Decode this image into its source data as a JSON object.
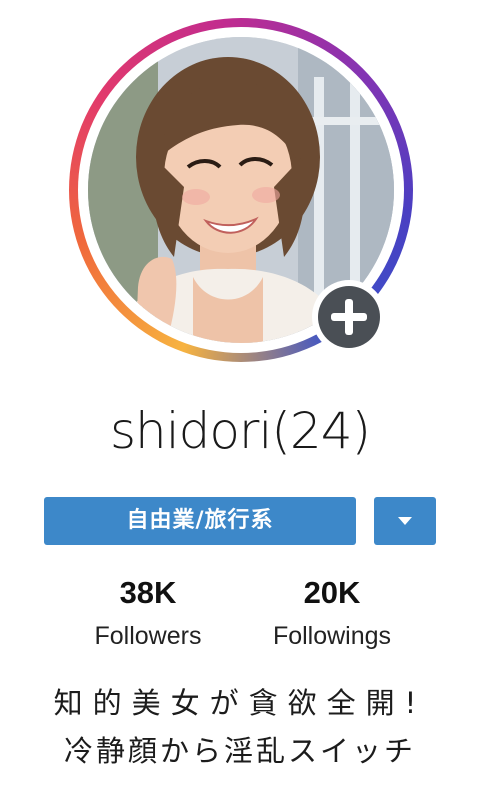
{
  "profile": {
    "username": "shidori(24)",
    "category_label": "自由業/旅行系",
    "stats": {
      "followers_count": "38K",
      "followers_label": "Followers",
      "followings_count": "20K",
      "followings_label": "Followings"
    },
    "bio": {
      "line1": "知的美女が貪欲全開!",
      "line2": "冷静顔から淫乱スイッチ"
    }
  },
  "icons": {
    "add": "plus-icon",
    "dropdown": "caret-down-icon"
  },
  "colors": {
    "button_blue": "#3d88c9",
    "badge_gray": "#4a4f55",
    "ring_gradient": [
      "#f7b340",
      "#f0693b",
      "#e23a6b",
      "#c12b8f",
      "#8534b3",
      "#3b52c9"
    ]
  }
}
